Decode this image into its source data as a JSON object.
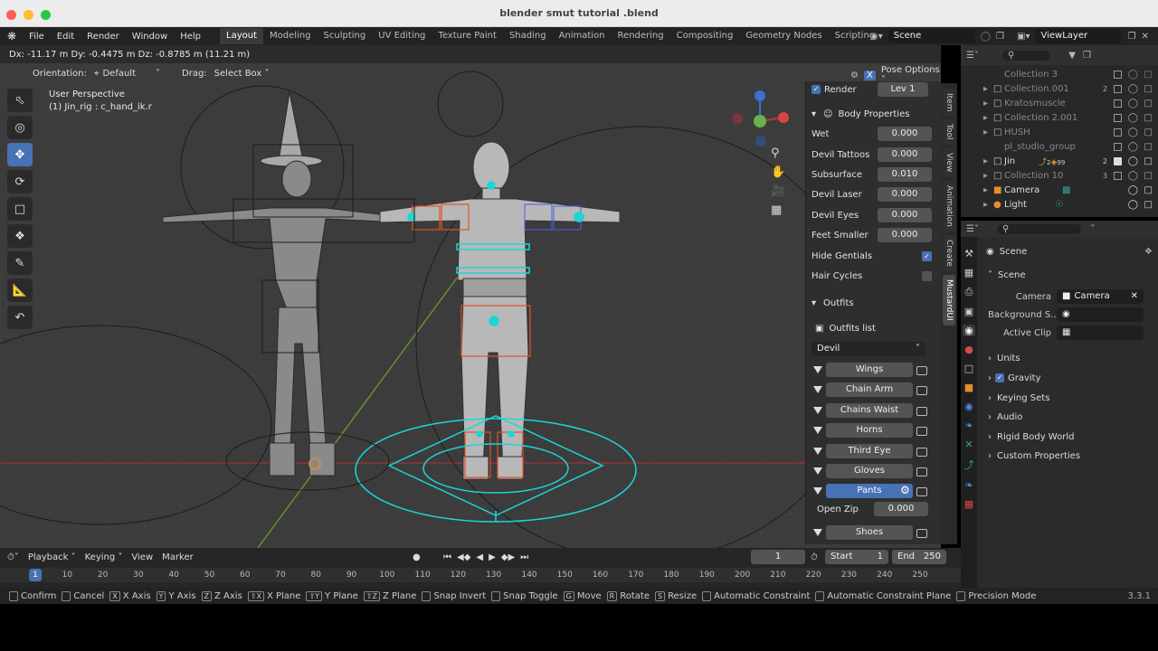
{
  "window": {
    "title": "blender smut tutorial .blend"
  },
  "menu": [
    "File",
    "Edit",
    "Render",
    "Window",
    "Help"
  ],
  "workspaces": [
    "Layout",
    "Modeling",
    "Sculpting",
    "UV Editing",
    "Texture Paint",
    "Shading",
    "Animation",
    "Rendering",
    "Compositing",
    "Geometry Nodes",
    "Scripting"
  ],
  "scene_field": "Scene",
  "viewlayer_field": "ViewLayer",
  "viewport": {
    "header_text": "Dx: -11.17 m   Dy: -0.4475 m   Dz: -0.8785 m (11.21 m)",
    "orientation_label": "Orientation:",
    "orientation_value": "Default",
    "drag_label": "Drag:",
    "drag_value": "Select Box",
    "x_badge": "X",
    "pose_options": "Pose Options",
    "perspective": "User Perspective",
    "active_bone": "(1) Jin_rig : c_hand_ik.r"
  },
  "npanel": {
    "render_label": "Render",
    "lev_label": "Lev  1",
    "body_header": "Body Properties",
    "props": [
      {
        "label": "Wet",
        "value": "0.000"
      },
      {
        "label": "Devil Tattoos",
        "value": "0.000"
      },
      {
        "label": "Subsurface",
        "value": "0.010"
      },
      {
        "label": "Devil Laser",
        "value": "0.000"
      },
      {
        "label": "Devil Eyes",
        "value": "0.000"
      },
      {
        "label": "Feet Smaller",
        "value": "0.000"
      }
    ],
    "hide_genitals": "Hide Gentials",
    "hair_cycles": "Hair Cycles",
    "outfits_header": "Outfits",
    "outfits_list": "Outfits list",
    "outfit_select": "Devil",
    "outfits": [
      "Wings",
      "Chain Arm",
      "Chains Waist",
      "Horns",
      "Third Eye",
      "Gloves",
      "Pants"
    ],
    "open_zip_label": "Open Zip",
    "open_zip_value": "0.000",
    "shoes": "Shoes",
    "tabs": [
      "Item",
      "Tool",
      "View",
      "Animation",
      "Create",
      "MustardUI"
    ]
  },
  "outliner": {
    "rows": [
      "Collection 3",
      "Collection.001",
      "Kratosmuscle",
      "Collection 2.001",
      "HUSH",
      "pl_studio_group",
      "Jin",
      "Collection 10",
      "Camera",
      "Light"
    ],
    "jin_count1": "2",
    "jin_count2": "99",
    "jin_count3": "2",
    "collection001_count": "2",
    "collection10_count": "3"
  },
  "properties": {
    "header": "Scene",
    "section": "Scene",
    "camera_label": "Camera",
    "camera_value": "Camera",
    "background_label": "Background S...",
    "active_clip_label": "Active Clip",
    "panels": [
      "Units",
      "Gravity",
      "Keying Sets",
      "Audio",
      "Rigid Body World",
      "Custom Properties"
    ]
  },
  "timeline": {
    "playback": "Playback",
    "keying": "Keying",
    "view": "View",
    "marker": "Marker",
    "current_frame": "1",
    "start_label": "Start",
    "start_value": "1",
    "end_label": "End",
    "end_value": "250",
    "ticks": [
      "1",
      "10",
      "20",
      "30",
      "40",
      "50",
      "60",
      "70",
      "80",
      "90",
      "100",
      "110",
      "120",
      "130",
      "140",
      "150",
      "160",
      "170",
      "180",
      "190",
      "200",
      "210",
      "220",
      "230",
      "240",
      "250"
    ]
  },
  "status": {
    "items": [
      "Confirm",
      "Cancel",
      "X Axis",
      "Y Axis",
      "Z Axis",
      "X Plane",
      "Y Plane",
      "Z Plane",
      "Snap Invert",
      "Snap Toggle",
      "Move",
      "Rotate",
      "Resize",
      "Automatic Constraint",
      "Automatic Constraint Plane",
      "Precision Mode"
    ],
    "keys": [
      "",
      "",
      "X",
      "Y",
      "Z",
      "⇧X",
      "⇧Y",
      "⇧Z",
      "",
      "",
      "G",
      "R",
      "S",
      "",
      "",
      ""
    ],
    "version": "3.3.1"
  },
  "colors": {
    "accent": "#4772b3",
    "gizmo_cyan": "#1bd6d6",
    "axis_red": "#c0392b",
    "axis_green": "#6ab04c"
  }
}
